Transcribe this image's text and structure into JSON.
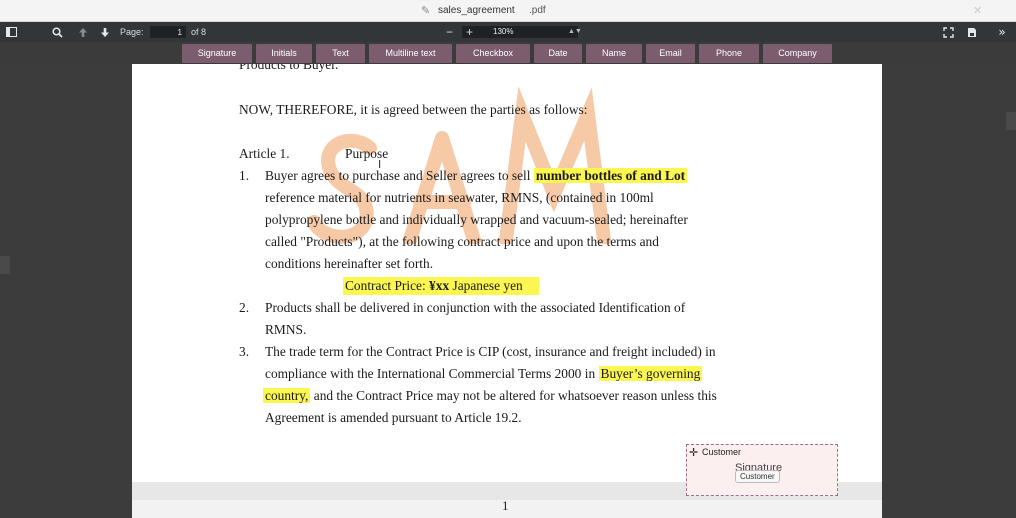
{
  "window": {
    "filename": "sales_agreement",
    "extension": ".pdf",
    "edit_icon": "pencil-icon",
    "close_icon": "close-icon"
  },
  "toolbar": {
    "page_label": "Page:",
    "current_page": "1",
    "page_total": "of 8",
    "zoom_minus": "−",
    "zoom_plus": "+",
    "zoom": "130%",
    "icons": [
      "sidebar-icon",
      "search-icon",
      "arrow-up-icon",
      "arrow-down-icon",
      "fit-icon",
      "save-icon",
      "more-icon"
    ]
  },
  "fields": [
    "Signature",
    "Initials",
    "Text",
    "Multiline text",
    "Checkbox",
    "Date",
    "Name",
    "Email",
    "Phone",
    "Company"
  ],
  "document": {
    "line_top": "Products to Buyer.",
    "para_therefore": "NOW, THEREFORE, it is agreed between the parties as follows:",
    "article_num": "Article 1.",
    "article_title": "Purpose",
    "item1_num": "1.",
    "item1_l1": "Buyer agrees to purchase and Seller agrees to sell",
    "item1_hl": "number bottles of and Lot",
    "item1_l2": "reference material for nutrients in seawater, RMNS, (contained in 100ml",
    "item1_l3": "polypropylene bottle and individually wrapped and vacuum-sealed; hereinafter",
    "item1_l4": "called \"Products\"), at the following contract price and upon the terms and",
    "item1_l5": "conditions hereinafter set forth.",
    "price_label": "Contract Price: ",
    "price_value": "¥xx",
    "price_unit": " Japanese yen",
    "item2_num": "2.",
    "item2_l1": "Products shall be delivered in conjunction with the associated Identification of",
    "item2_l2": "RMNS.",
    "item3_num": "3.",
    "item3_l1": "The trade term for the Contract Price is CIP (cost, insurance and freight included) in",
    "item3_l2a": "compliance with the International Commercial Terms 2000 in",
    "item3_hl1": "Buyer’s governing",
    "item3_hl2": "country,",
    "item3_l3b": "and the Contract Price may not be altered for whatsoever reason unless this",
    "item3_l4": "Agreement is amended pursuant to Article 19.2.",
    "page_number": "1"
  },
  "signature_field": {
    "role": "Customer",
    "label": "Signature",
    "chip": "Customer",
    "highlight_color": "#fbf650",
    "field_color": "#7c5d6f"
  }
}
